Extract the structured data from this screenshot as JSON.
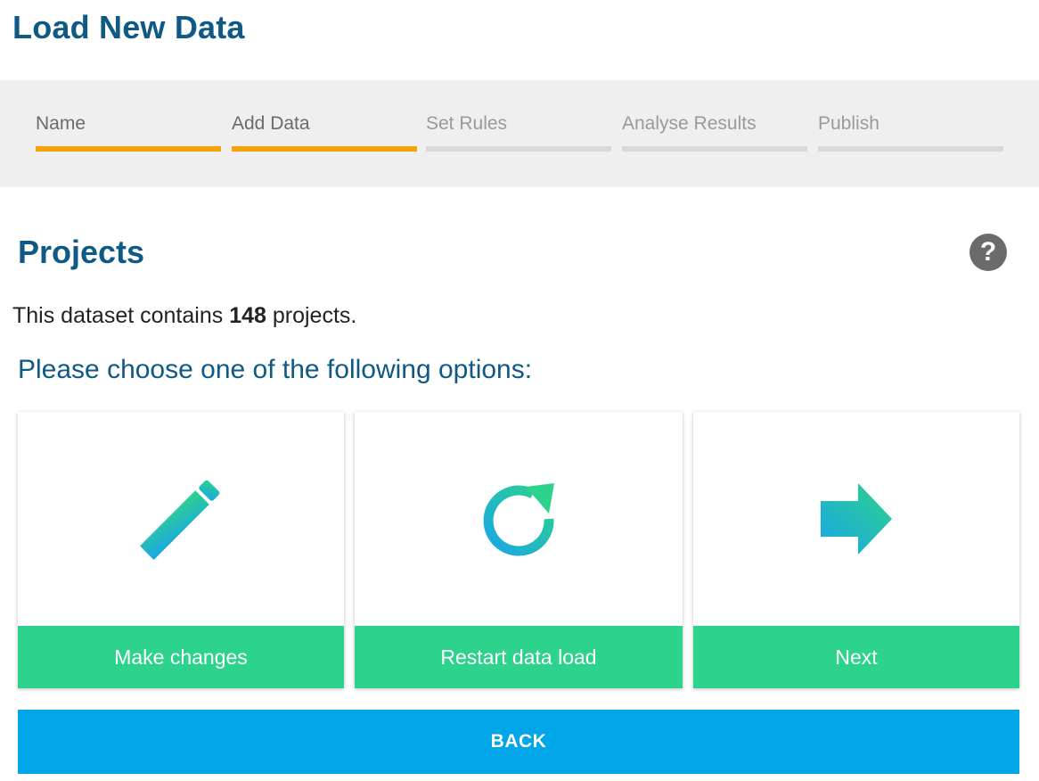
{
  "page": {
    "title": "Load New Data"
  },
  "stepper": {
    "steps": [
      {
        "label": "Name",
        "state": "done"
      },
      {
        "label": "Add Data",
        "state": "done"
      },
      {
        "label": "Set Rules",
        "state": "pending"
      },
      {
        "label": "Analyse Results",
        "state": "pending"
      },
      {
        "label": "Publish",
        "state": "pending"
      }
    ]
  },
  "section": {
    "title": "Projects",
    "help_icon": "question-circle-icon"
  },
  "summary": {
    "prefix": "This dataset contains",
    "count": "148",
    "suffix": "projects."
  },
  "prompt": "Please choose one of the following options:",
  "options": [
    {
      "icon": "pencil-icon",
      "label": "Make changes"
    },
    {
      "icon": "refresh-icon",
      "label": "Restart data load"
    },
    {
      "icon": "arrow-right-icon",
      "label": "Next"
    }
  ],
  "back_button": {
    "label": "BACK"
  },
  "colors": {
    "title": "#0f5a85",
    "step_done": "#f5a30a",
    "step_pending": "#d9d9d9",
    "card_button": "#2dd28c",
    "back_button": "#00a6e8",
    "icon_gradient_start": "#1aa6e6",
    "icon_gradient_end": "#2dd28c"
  }
}
